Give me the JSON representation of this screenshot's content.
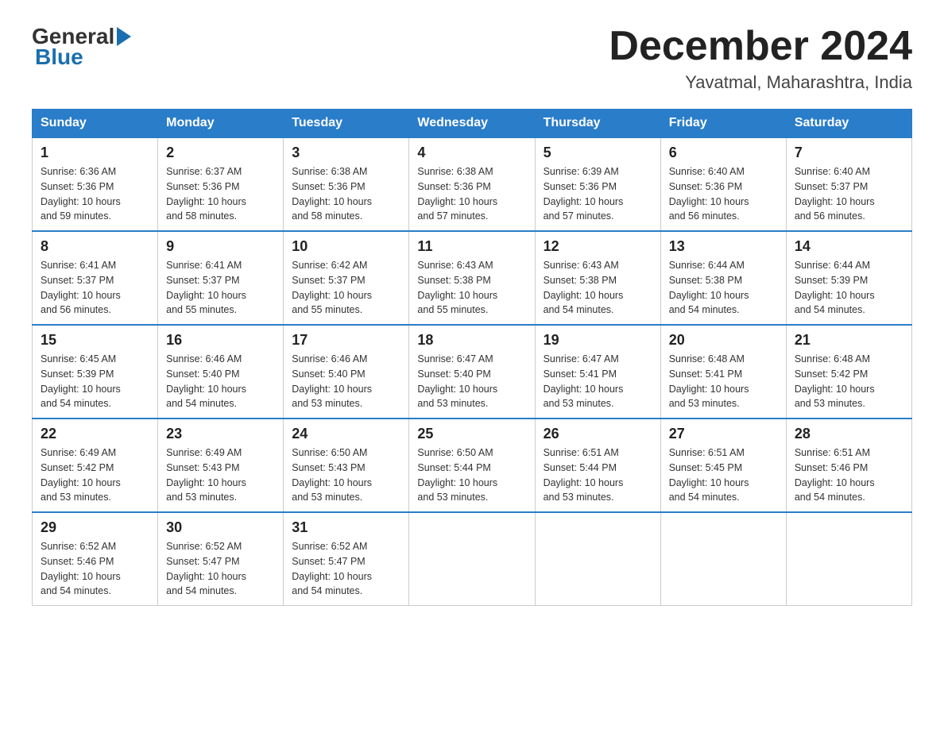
{
  "header": {
    "logo": {
      "general": "General",
      "blue": "Blue"
    },
    "title": "December 2024",
    "subtitle": "Yavatmal, Maharashtra, India"
  },
  "weekdays": [
    "Sunday",
    "Monday",
    "Tuesday",
    "Wednesday",
    "Thursday",
    "Friday",
    "Saturday"
  ],
  "weeks": [
    [
      {
        "day": "1",
        "sunrise": "6:36 AM",
        "sunset": "5:36 PM",
        "daylight": "10 hours and 59 minutes."
      },
      {
        "day": "2",
        "sunrise": "6:37 AM",
        "sunset": "5:36 PM",
        "daylight": "10 hours and 58 minutes."
      },
      {
        "day": "3",
        "sunrise": "6:38 AM",
        "sunset": "5:36 PM",
        "daylight": "10 hours and 58 minutes."
      },
      {
        "day": "4",
        "sunrise": "6:38 AM",
        "sunset": "5:36 PM",
        "daylight": "10 hours and 57 minutes."
      },
      {
        "day": "5",
        "sunrise": "6:39 AM",
        "sunset": "5:36 PM",
        "daylight": "10 hours and 57 minutes."
      },
      {
        "day": "6",
        "sunrise": "6:40 AM",
        "sunset": "5:36 PM",
        "daylight": "10 hours and 56 minutes."
      },
      {
        "day": "7",
        "sunrise": "6:40 AM",
        "sunset": "5:37 PM",
        "daylight": "10 hours and 56 minutes."
      }
    ],
    [
      {
        "day": "8",
        "sunrise": "6:41 AM",
        "sunset": "5:37 PM",
        "daylight": "10 hours and 56 minutes."
      },
      {
        "day": "9",
        "sunrise": "6:41 AM",
        "sunset": "5:37 PM",
        "daylight": "10 hours and 55 minutes."
      },
      {
        "day": "10",
        "sunrise": "6:42 AM",
        "sunset": "5:37 PM",
        "daylight": "10 hours and 55 minutes."
      },
      {
        "day": "11",
        "sunrise": "6:43 AM",
        "sunset": "5:38 PM",
        "daylight": "10 hours and 55 minutes."
      },
      {
        "day": "12",
        "sunrise": "6:43 AM",
        "sunset": "5:38 PM",
        "daylight": "10 hours and 54 minutes."
      },
      {
        "day": "13",
        "sunrise": "6:44 AM",
        "sunset": "5:38 PM",
        "daylight": "10 hours and 54 minutes."
      },
      {
        "day": "14",
        "sunrise": "6:44 AM",
        "sunset": "5:39 PM",
        "daylight": "10 hours and 54 minutes."
      }
    ],
    [
      {
        "day": "15",
        "sunrise": "6:45 AM",
        "sunset": "5:39 PM",
        "daylight": "10 hours and 54 minutes."
      },
      {
        "day": "16",
        "sunrise": "6:46 AM",
        "sunset": "5:40 PM",
        "daylight": "10 hours and 54 minutes."
      },
      {
        "day": "17",
        "sunrise": "6:46 AM",
        "sunset": "5:40 PM",
        "daylight": "10 hours and 53 minutes."
      },
      {
        "day": "18",
        "sunrise": "6:47 AM",
        "sunset": "5:40 PM",
        "daylight": "10 hours and 53 minutes."
      },
      {
        "day": "19",
        "sunrise": "6:47 AM",
        "sunset": "5:41 PM",
        "daylight": "10 hours and 53 minutes."
      },
      {
        "day": "20",
        "sunrise": "6:48 AM",
        "sunset": "5:41 PM",
        "daylight": "10 hours and 53 minutes."
      },
      {
        "day": "21",
        "sunrise": "6:48 AM",
        "sunset": "5:42 PM",
        "daylight": "10 hours and 53 minutes."
      }
    ],
    [
      {
        "day": "22",
        "sunrise": "6:49 AM",
        "sunset": "5:42 PM",
        "daylight": "10 hours and 53 minutes."
      },
      {
        "day": "23",
        "sunrise": "6:49 AM",
        "sunset": "5:43 PM",
        "daylight": "10 hours and 53 minutes."
      },
      {
        "day": "24",
        "sunrise": "6:50 AM",
        "sunset": "5:43 PM",
        "daylight": "10 hours and 53 minutes."
      },
      {
        "day": "25",
        "sunrise": "6:50 AM",
        "sunset": "5:44 PM",
        "daylight": "10 hours and 53 minutes."
      },
      {
        "day": "26",
        "sunrise": "6:51 AM",
        "sunset": "5:44 PM",
        "daylight": "10 hours and 53 minutes."
      },
      {
        "day": "27",
        "sunrise": "6:51 AM",
        "sunset": "5:45 PM",
        "daylight": "10 hours and 54 minutes."
      },
      {
        "day": "28",
        "sunrise": "6:51 AM",
        "sunset": "5:46 PM",
        "daylight": "10 hours and 54 minutes."
      }
    ],
    [
      {
        "day": "29",
        "sunrise": "6:52 AM",
        "sunset": "5:46 PM",
        "daylight": "10 hours and 54 minutes."
      },
      {
        "day": "30",
        "sunrise": "6:52 AM",
        "sunset": "5:47 PM",
        "daylight": "10 hours and 54 minutes."
      },
      {
        "day": "31",
        "sunrise": "6:52 AM",
        "sunset": "5:47 PM",
        "daylight": "10 hours and 54 minutes."
      },
      null,
      null,
      null,
      null
    ]
  ],
  "labels": {
    "sunrise": "Sunrise:",
    "sunset": "Sunset:",
    "daylight": "Daylight:"
  }
}
